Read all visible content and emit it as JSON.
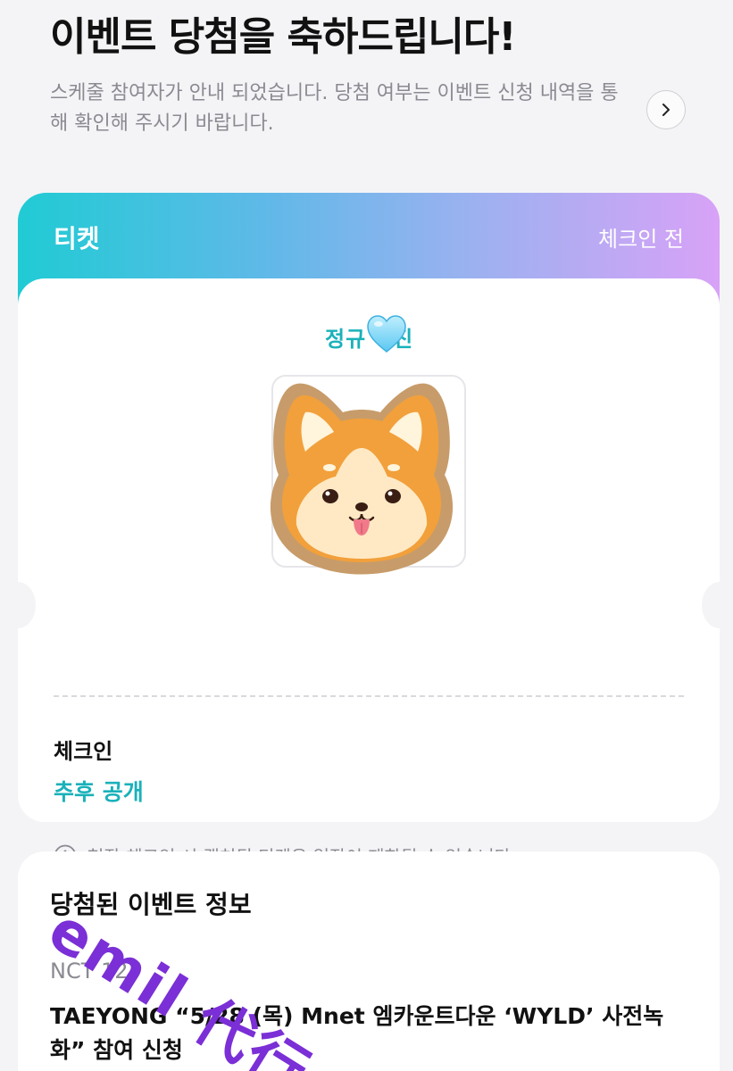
{
  "header": {
    "title": "이벤트 당첨을 축하드립니다!",
    "subtitle": "스케줄 참여자가 안내 되었습니다. 당첨 여부는 이벤트 신청 내역을 통해 확인해 주시기 바랍니다."
  },
  "ticket": {
    "title": "티켓",
    "status": "체크인 전",
    "name_label": "정규",
    "name_label_end": "진",
    "checkin_label": "체크인",
    "checkin_value": "추후 공개",
    "notice": "현장 체크인 시 캡처된 티켓은 입장이 제한될 수 있습니다."
  },
  "event_info": {
    "title": "당첨된 이벤트 정보",
    "artist": "NCT 127",
    "event_name": "TAEYONG “5/28 (목) Mnet 엠카운트다운 ‘WYLD’ 사전녹화” 참여 신청"
  },
  "watermark": {
    "text": "emil 代行"
  },
  "colors": {
    "accent": "#1ab1ba",
    "gradient_start": "#20cbd4",
    "gradient_end": "#d8a2f7",
    "watermark": "#7b2fd6"
  }
}
